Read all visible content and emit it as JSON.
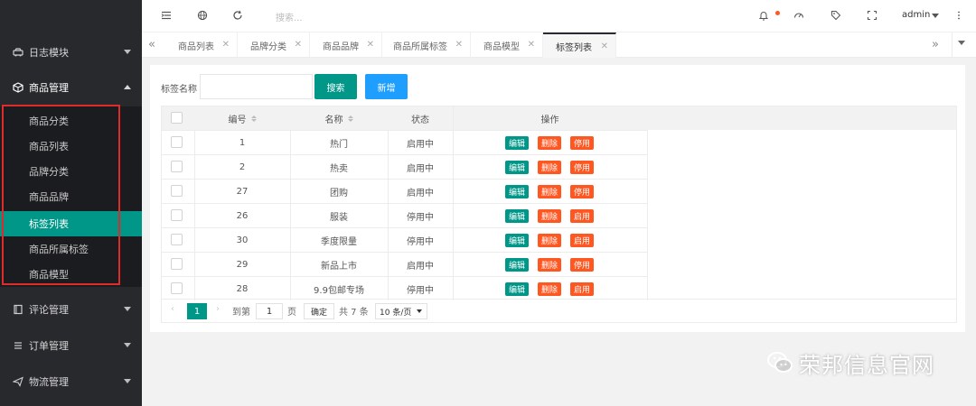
{
  "sidebar": {
    "groups": [
      {
        "label": "日志模块",
        "icon": "car-icon"
      },
      {
        "label": "商品管理",
        "icon": "cube-icon"
      },
      {
        "label": "评论管理",
        "icon": "book-icon"
      },
      {
        "label": "订单管理",
        "icon": "list-icon"
      },
      {
        "label": "物流管理",
        "icon": "send-icon"
      }
    ],
    "submenu": [
      {
        "label": "商品分类"
      },
      {
        "label": "商品列表"
      },
      {
        "label": "品牌分类"
      },
      {
        "label": "商品品牌"
      },
      {
        "label": "标签列表"
      },
      {
        "label": "商品所属标签"
      },
      {
        "label": "商品模型"
      }
    ],
    "selected_index": 4,
    "accent": "#009688"
  },
  "topbar": {
    "search_placeholder": "搜索...",
    "user": "admin"
  },
  "tabs": [
    {
      "label": "商品列表"
    },
    {
      "label": "品牌分类"
    },
    {
      "label": "商品品牌"
    },
    {
      "label": "商品所属标签"
    },
    {
      "label": "商品模型"
    },
    {
      "label": "标签列表"
    }
  ],
  "filter": {
    "label": "标签名称",
    "value": "",
    "search_btn": "搜索",
    "add_btn": "新增"
  },
  "table": {
    "headers": {
      "id": "编号",
      "name": "名称",
      "status": "状态",
      "ops": "操作"
    },
    "rows": [
      {
        "id": "1",
        "name": "热门",
        "status": "启用中",
        "toggle": "停用"
      },
      {
        "id": "2",
        "name": "热卖",
        "status": "启用中",
        "toggle": "停用"
      },
      {
        "id": "27",
        "name": "团购",
        "status": "启用中",
        "toggle": "停用"
      },
      {
        "id": "26",
        "name": "服装",
        "status": "停用中",
        "toggle": "启用"
      },
      {
        "id": "30",
        "name": "季度限量",
        "status": "停用中",
        "toggle": "启用"
      },
      {
        "id": "29",
        "name": "新品上市",
        "status": "启用中",
        "toggle": "停用"
      },
      {
        "id": "28",
        "name": "9.9包邮专场",
        "status": "停用中",
        "toggle": "启用"
      }
    ],
    "edit_label": "编辑",
    "delete_label": "删除"
  },
  "pager": {
    "current": "1",
    "goto_label": "到第",
    "goto_value": "1",
    "page_unit": "页",
    "confirm": "确定",
    "total": "共 7 条",
    "page_size": "10 条/页"
  },
  "watermark": {
    "text": "荣邦信息官网"
  }
}
